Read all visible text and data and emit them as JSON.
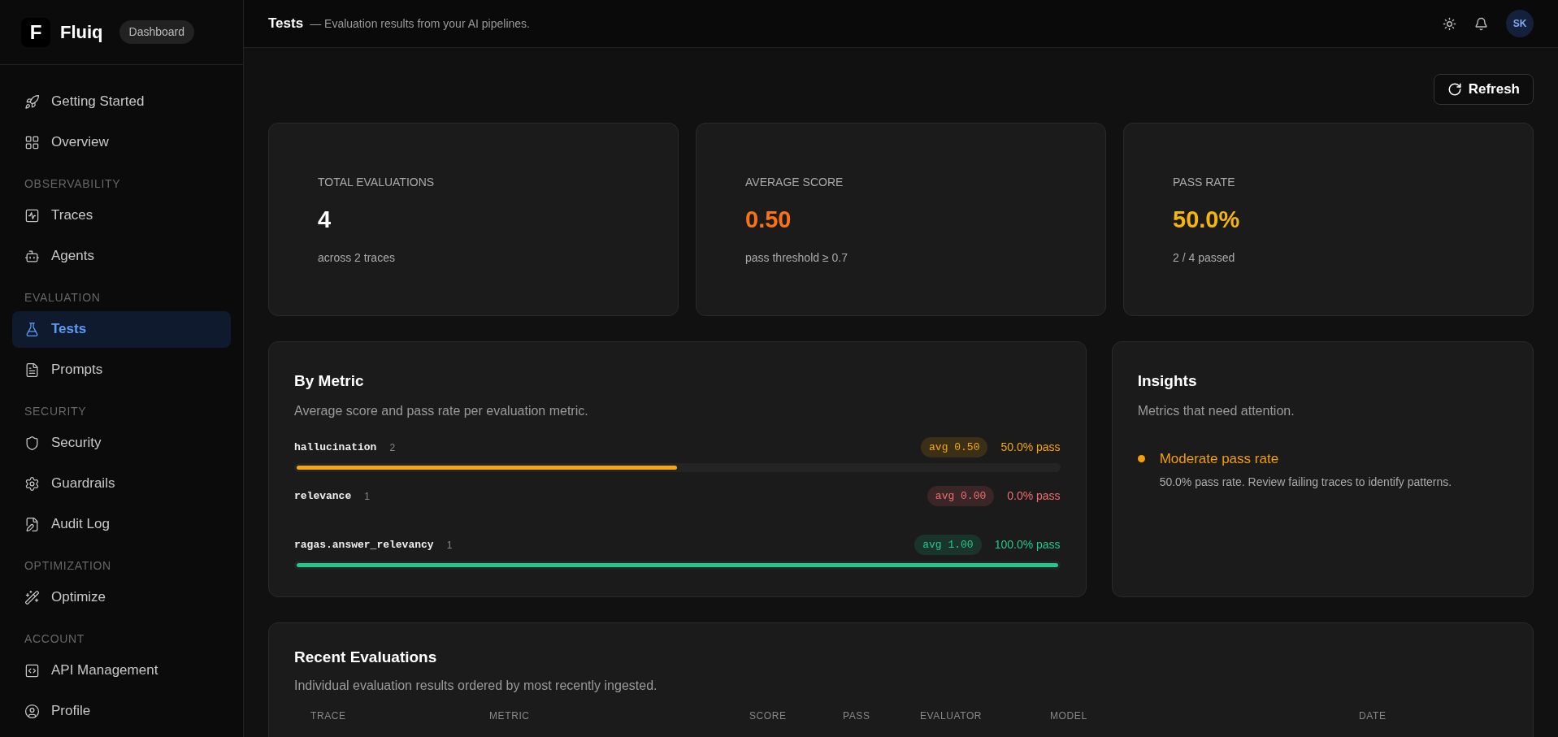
{
  "brand": {
    "logo": "F",
    "name": "Fluiq",
    "badge": "Dashboard"
  },
  "sidebar": {
    "groups": [
      {
        "items": [
          {
            "label": "Getting Started",
            "selected": false
          },
          {
            "label": "Overview",
            "selected": false
          }
        ]
      },
      {
        "label": "OBSERVABILITY",
        "items": [
          {
            "label": "Traces",
            "selected": false
          },
          {
            "label": "Agents",
            "selected": false
          }
        ]
      },
      {
        "label": "EVALUATION",
        "items": [
          {
            "label": "Tests",
            "selected": true
          },
          {
            "label": "Prompts",
            "selected": false
          }
        ]
      },
      {
        "label": "SECURITY",
        "items": [
          {
            "label": "Security",
            "selected": false
          },
          {
            "label": "Guardrails",
            "selected": false
          },
          {
            "label": "Audit Log",
            "selected": false
          }
        ]
      },
      {
        "label": "OPTIMIZATION",
        "items": [
          {
            "label": "Optimize",
            "selected": false
          }
        ]
      },
      {
        "label": "ACCOUNT",
        "items": [
          {
            "label": "API Management",
            "selected": false
          },
          {
            "label": "Profile",
            "selected": false
          }
        ]
      }
    ]
  },
  "header": {
    "title": "Tests",
    "subtitle": "— Evaluation results from your AI pipelines.",
    "avatar": "SK"
  },
  "refresh_button": "Refresh",
  "stats": [
    {
      "label": "TOTAL EVALUATIONS",
      "value": "4",
      "note": "across 2 traces",
      "color": "#ffffff"
    },
    {
      "label": "AVERAGE SCORE",
      "value": "0.50",
      "note": "pass threshold ≥ 0.7",
      "color": "#f97316"
    },
    {
      "label": "PASS RATE",
      "value": "50.0%",
      "note": "2 / 4 passed",
      "color": "#f5b50b"
    }
  ],
  "by_metric": {
    "title": "By Metric",
    "subtitle": "Average score and pass rate per evaluation metric.",
    "metrics": [
      {
        "name": "hallucination",
        "count": "2",
        "avg": "avg 0.50",
        "pass": "50.0% pass",
        "color": "#f5a70b",
        "level": 0.5
      },
      {
        "name": "relevance",
        "count": "1",
        "avg": "avg 0.00",
        "pass": "0.0% pass",
        "color": "#f26d6d"
      },
      {
        "name": "ragas.answer_relevancy",
        "count": "1",
        "avg": "avg 1.00",
        "pass": "100.0% pass",
        "color": "#22c98a",
        "level": 1
      }
    ]
  },
  "insights": {
    "title": "Insights",
    "subtitle": "Metrics that need attention.",
    "items": [
      {
        "title": "Moderate pass rate",
        "text": "50.0% pass rate. Review failing traces to identify patterns.",
        "color": "#f59e0b"
      }
    ]
  },
  "recent": {
    "title": "Recent Evaluations",
    "subtitle": "Individual evaluation results ordered by most recently ingested.",
    "columns": [
      "TRACE",
      "METRIC",
      "SCORE",
      "PASS",
      "EVALUATOR",
      "MODEL",
      "DATE"
    ]
  }
}
